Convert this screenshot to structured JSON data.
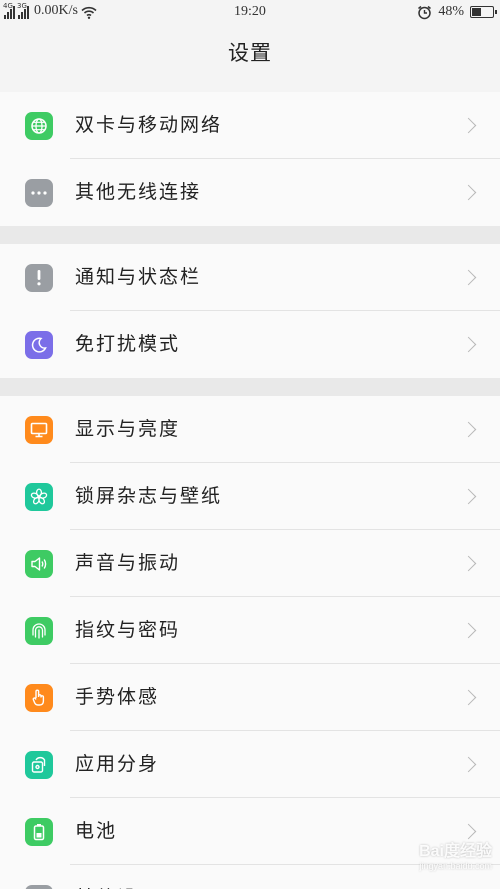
{
  "status_bar": {
    "network_tag_1": "4G",
    "network_tag_2": "3G",
    "net_speed": "0.00K/s",
    "time": "19:20",
    "battery": "48%",
    "battery_level": 0.48
  },
  "header": {
    "title": "设置"
  },
  "colors": {
    "green": "#3ecb63",
    "gray": "#9a9ea3",
    "purple": "#7b6ee8",
    "orange": "#ff8a1c",
    "teal": "#1fc89b"
  },
  "groups": [
    {
      "items": [
        {
          "label": "双卡与移动网络",
          "icon": "globe-icon",
          "color": "#3ecb63"
        },
        {
          "label": "其他无线连接",
          "icon": "more-dots-icon",
          "color": "#9a9ea3"
        }
      ]
    },
    {
      "items": [
        {
          "label": "通知与状态栏",
          "icon": "exclamation-icon",
          "color": "#9a9ea3"
        },
        {
          "label": "免打扰模式",
          "icon": "moon-icon",
          "color": "#7b6ee8"
        }
      ]
    },
    {
      "items": [
        {
          "label": "显示与亮度",
          "icon": "monitor-icon",
          "color": "#ff8a1c"
        },
        {
          "label": "锁屏杂志与壁纸",
          "icon": "flower-icon",
          "color": "#1fc89b"
        },
        {
          "label": "声音与振动",
          "icon": "speaker-icon",
          "color": "#3ecb63"
        },
        {
          "label": "指纹与密码",
          "icon": "fingerprint-icon",
          "color": "#3ecb63"
        },
        {
          "label": "手势体感",
          "icon": "hand-gesture-icon",
          "color": "#ff8a1c"
        },
        {
          "label": "应用分身",
          "icon": "app-clone-icon",
          "color": "#1fc89b"
        },
        {
          "label": "电池",
          "icon": "battery-icon",
          "color": "#3ecb63"
        },
        {
          "label": "其他设置",
          "icon": "settings-icon",
          "color": "#9a9ea3"
        }
      ]
    }
  ],
  "watermark": {
    "line1": "Bai度经验",
    "line2": "jingyan.baidu.com"
  }
}
